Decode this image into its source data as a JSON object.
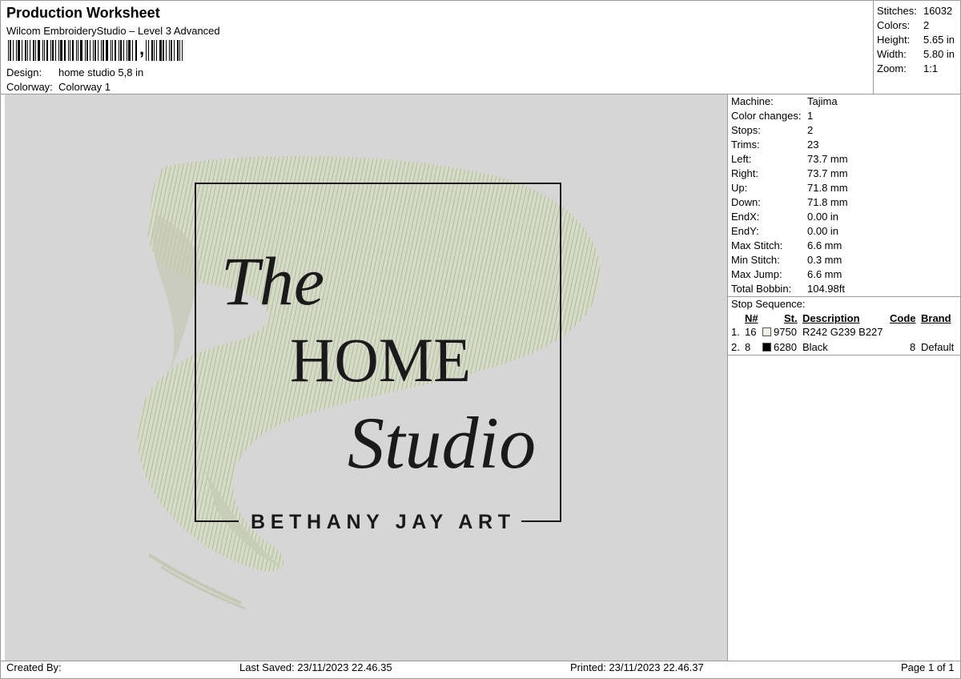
{
  "header": {
    "title": "Production Worksheet",
    "software": "Wilcom EmbroideryStudio – Level 3 Advanced",
    "design_label": "Design:",
    "design_value": "home studio 5,8 in",
    "colorway_label": "Colorway:",
    "colorway_value": "Colorway 1"
  },
  "summary": {
    "stitches_label": "Stitches:",
    "stitches_value": "16032",
    "colors_label": "Colors:",
    "colors_value": "2",
    "height_label": "Height:",
    "height_value": "5.65 in",
    "width_label": "Width:",
    "width_value": "5.80 in",
    "zoom_label": "Zoom:",
    "zoom_value": "1:1"
  },
  "machine_info": [
    {
      "label": "Machine:",
      "value": "Tajima"
    },
    {
      "label": "Color changes:",
      "value": "1"
    },
    {
      "label": "Stops:",
      "value": "2"
    },
    {
      "label": "Trims:",
      "value": "23"
    },
    {
      "label": "Left:",
      "value": "73.7 mm"
    },
    {
      "label": "Right:",
      "value": "73.7 mm"
    },
    {
      "label": "Up:",
      "value": "71.8 mm"
    },
    {
      "label": "Down:",
      "value": "71.8 mm"
    },
    {
      "label": "EndX:",
      "value": "0.00 in"
    },
    {
      "label": "EndY:",
      "value": "0.00 in"
    },
    {
      "label": "Max Stitch:",
      "value": "6.6 mm"
    },
    {
      "label": "Min Stitch:",
      "value": "0.3 mm"
    },
    {
      "label": "Max Jump:",
      "value": "6.6 mm"
    },
    {
      "label": "Total Bobbin:",
      "value": "104.98ft"
    }
  ],
  "stop_sequence": {
    "title": "Stop Sequence:",
    "headers": {
      "n": "N#",
      "st": "St.",
      "description": "Description",
      "code": "Code",
      "brand": "Brand"
    },
    "rows": [
      {
        "index": "1.",
        "n": "16",
        "swatch_color": "#F2EFE3",
        "st": "9750",
        "description": "R242 G239 B227",
        "code": "",
        "brand": ""
      },
      {
        "index": "2.",
        "n": "8",
        "swatch_color": "#000000",
        "st": "6280",
        "description": "Black",
        "code": "8",
        "brand": "Default"
      }
    ]
  },
  "design_preview": {
    "line_1": "The",
    "line_2": "HOME",
    "line_3": "Studio",
    "line_4": "BETHANY JAY ART",
    "thread_light": "#d4d8c6",
    "thread_dark": "#1a1a1a"
  },
  "footer": {
    "created_by": "Created By:",
    "last_saved": "Last Saved: 23/11/2023 22.46.35",
    "printed": "Printed: 23/11/2023 22.46.37",
    "page": "Page 1 of 1"
  }
}
